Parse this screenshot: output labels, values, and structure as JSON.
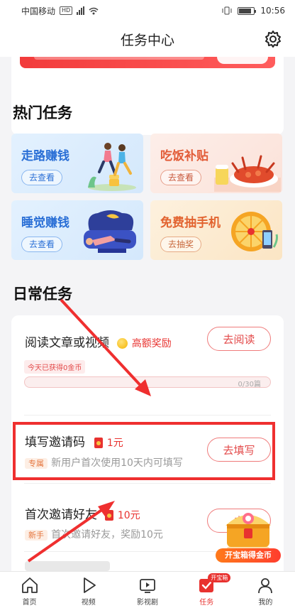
{
  "status_bar": {
    "carrier": "中国移动",
    "hd": "HD",
    "time": "10:56"
  },
  "header": {
    "title": "任务中心"
  },
  "hot_tasks": {
    "title": "热门任务",
    "items": [
      {
        "title": "走路赚钱",
        "button": "去查看"
      },
      {
        "title": "吃饭补贴",
        "button": "去查看"
      },
      {
        "title": "睡觉赚钱",
        "button": "去查看"
      },
      {
        "title": "免费抽手机",
        "button": "去抽奖"
      }
    ]
  },
  "daily_tasks": {
    "title": "日常任务",
    "read": {
      "title": "阅读文章或视频",
      "reward": "高额奖励",
      "button": "去阅读",
      "earned_note": "今天已获得0金币",
      "progress_text": "0/30篇",
      "progress": 0
    },
    "invite_code": {
      "title": "填写邀请码",
      "reward": "1元",
      "tag": "专属",
      "desc": "新用户首次使用10天内可填写",
      "button": "去填写"
    },
    "invite_friend": {
      "title": "首次邀请好友",
      "reward": "10元",
      "tag": "新手",
      "desc": "首次邀请好友，奖励10元",
      "button": "去"
    }
  },
  "treasure": {
    "label": "开宝箱得金币"
  },
  "tab_bar": {
    "items": [
      {
        "label": "首页"
      },
      {
        "label": "视频"
      },
      {
        "label": "影视剧"
      },
      {
        "label": "任务",
        "badge": "开宝箱"
      },
      {
        "label": "我的"
      }
    ]
  },
  "colors": {
    "accent": "#e8322f",
    "highlight_border": "#ef2f2f"
  }
}
